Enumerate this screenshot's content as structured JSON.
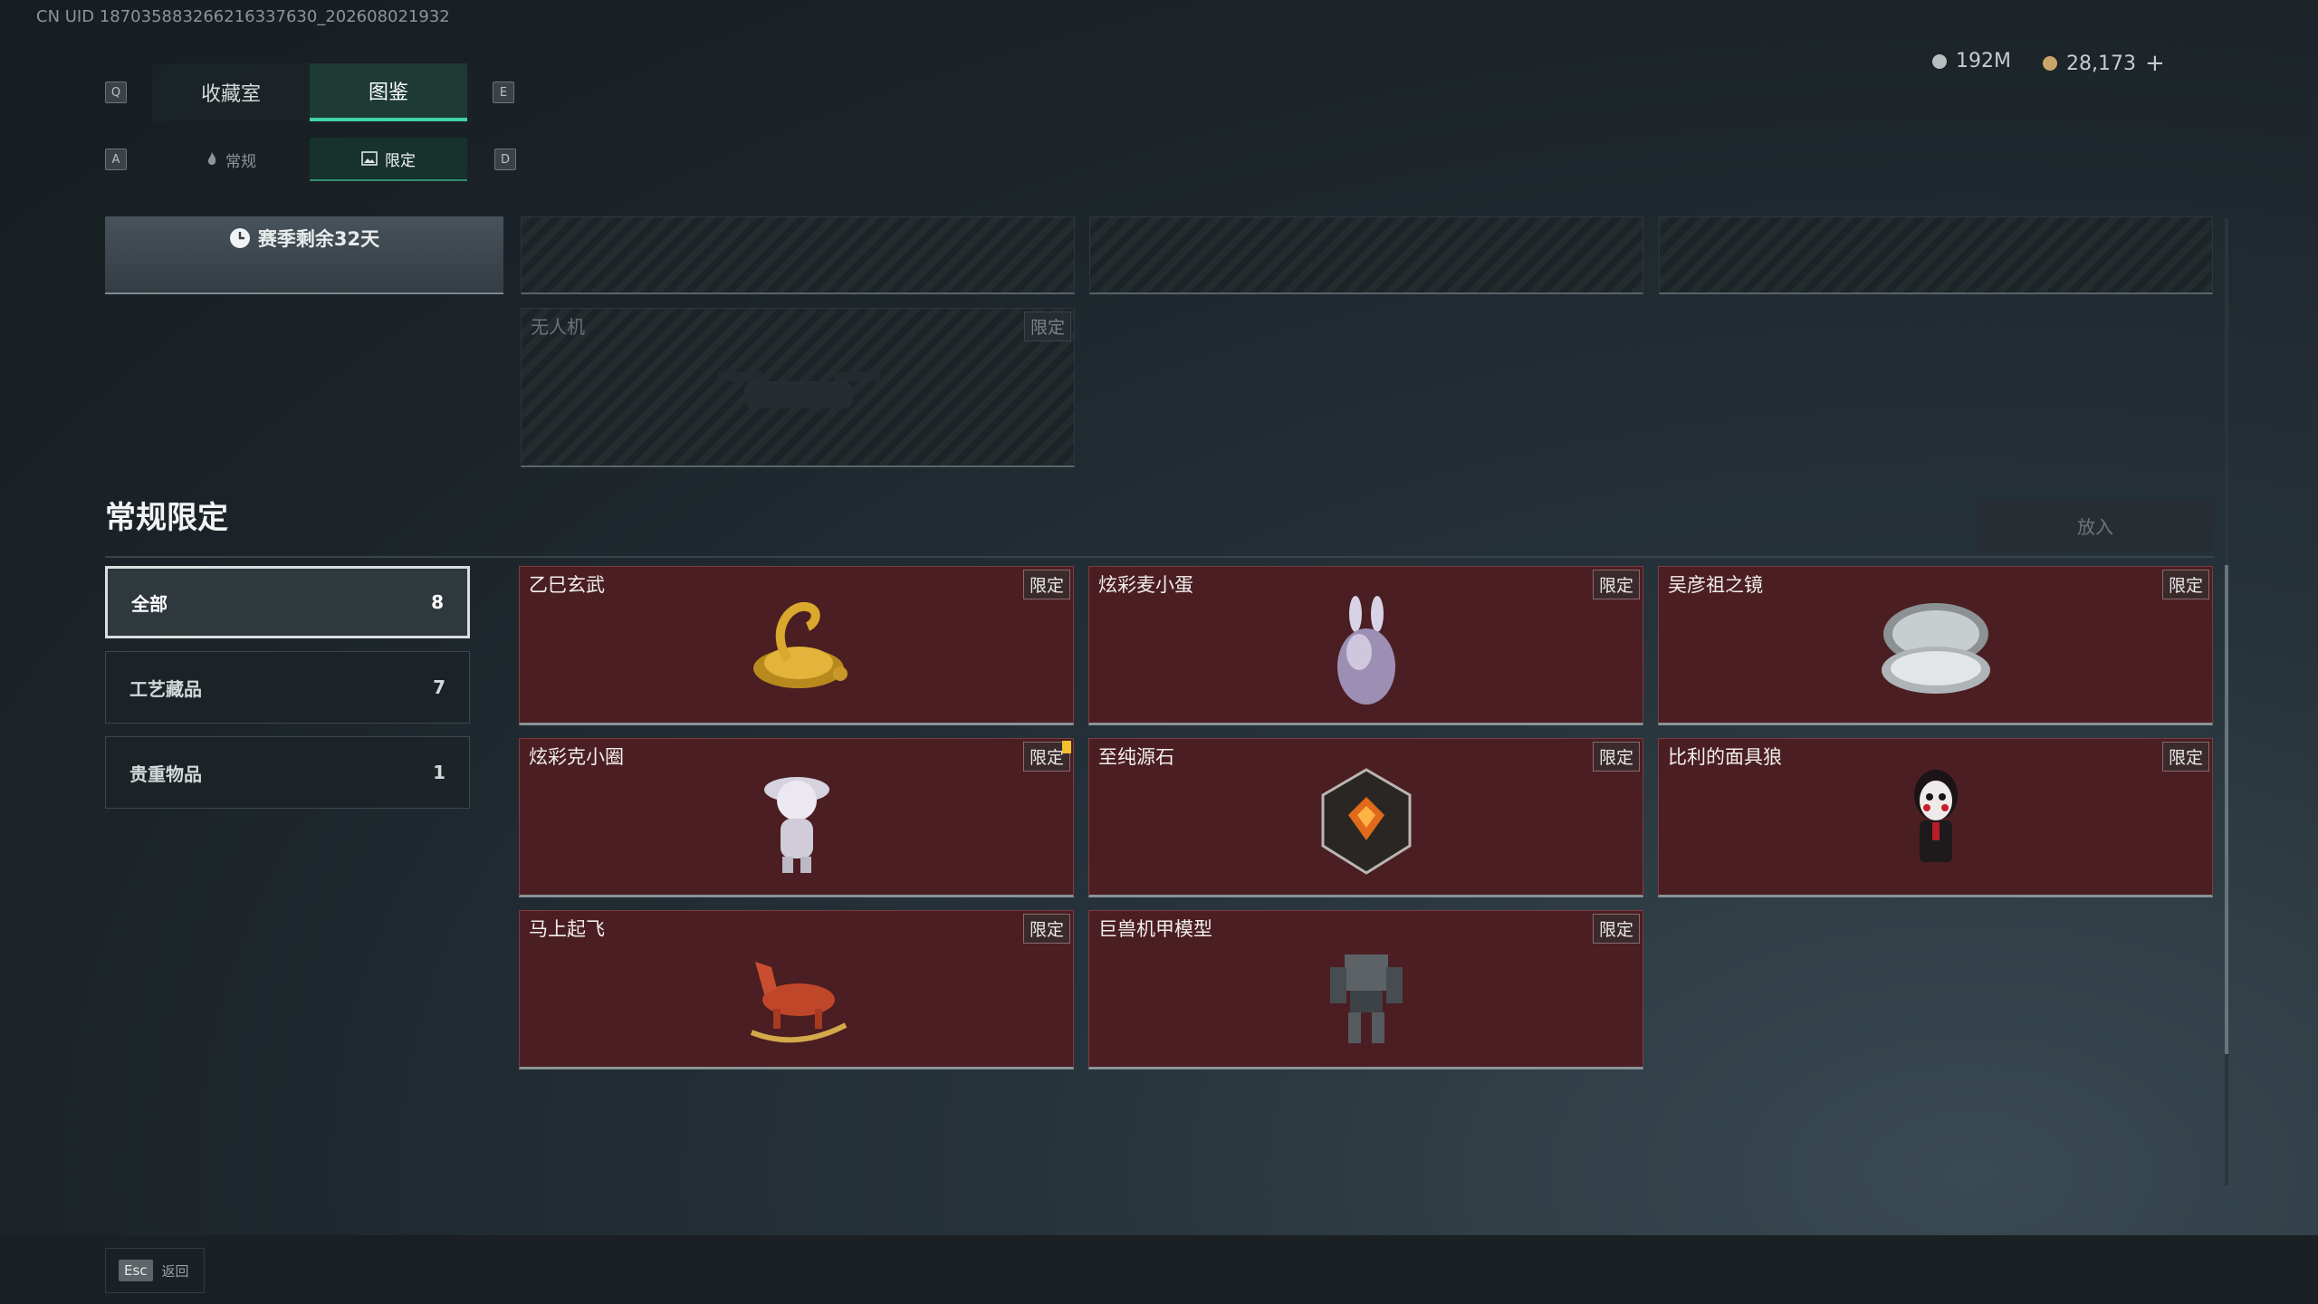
{
  "uid_text": "CN UID 187035883266216337630_202608021932",
  "tabs": {
    "left_key": "Q",
    "right_key": "E",
    "items": [
      {
        "label": "收藏室",
        "active": false
      },
      {
        "label": "图鉴",
        "active": true
      }
    ]
  },
  "subtabs": {
    "left_key": "A",
    "right_key": "D",
    "items": [
      {
        "label": "常规",
        "icon": "flame-icon",
        "active": false
      },
      {
        "label": "限定",
        "icon": "image-icon",
        "active": true
      }
    ]
  },
  "currency": {
    "silver": "192M",
    "gold": "28,173",
    "add_symbol": "+",
    "silver_color": "#b9bec0",
    "gold_color": "#c9a56a"
  },
  "season": {
    "remaining_text": "赛季剩余32天"
  },
  "top_locked_item": {
    "name": "无人机",
    "badge": "限定"
  },
  "section": {
    "title": "常规限定",
    "put_button": "放入"
  },
  "categories": [
    {
      "label": "全部",
      "count": "8",
      "active": true
    },
    {
      "label": "工艺藏品",
      "count": "7",
      "active": false
    },
    {
      "label": "贵重物品",
      "count": "1",
      "active": false
    }
  ],
  "items": [
    {
      "name": "乙巳玄武",
      "badge": "限定",
      "icon": "golden-snake-turtle-icon"
    },
    {
      "name": "炫彩麦小蛋",
      "badge": "限定",
      "icon": "rabbit-egg-icon"
    },
    {
      "name": "吴彦祖之镜",
      "badge": "限定",
      "icon": "compact-mirror-icon"
    },
    {
      "name": "炫彩克小圈",
      "badge": "限定",
      "icon": "cat-figure-icon",
      "notice": true
    },
    {
      "name": "至纯源石",
      "badge": "限定",
      "icon": "source-stone-icon"
    },
    {
      "name": "比利的面具狼",
      "badge": "限定",
      "icon": "puppet-mask-icon"
    },
    {
      "name": "马上起飞",
      "badge": "限定",
      "icon": "rocking-horse-icon"
    },
    {
      "name": "巨兽机甲模型",
      "badge": "限定",
      "icon": "mech-model-icon"
    }
  ],
  "footer": {
    "key": "Esc",
    "label": "返回"
  },
  "colors": {
    "accent": "#3fd3a3",
    "card_bg": "#4a1e22"
  }
}
